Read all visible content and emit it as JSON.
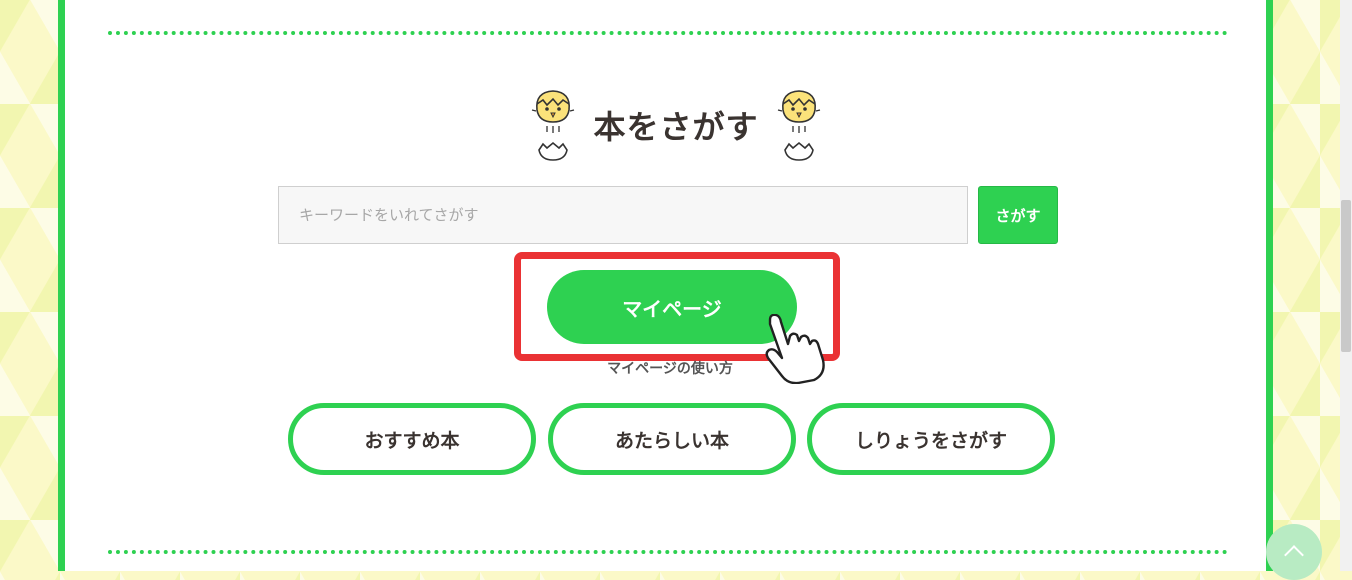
{
  "search_section": {
    "heading": "本をさがす",
    "search_input": {
      "value": "",
      "placeholder": "キーワードをいれてさがす"
    },
    "search_button_label": "さがす",
    "mypage_button_label": "マイページ",
    "mypage_help_link": "マイページの使い方",
    "category_buttons": [
      {
        "label": "おすすめ本"
      },
      {
        "label": "あたらしい本"
      },
      {
        "label": "しりょうをさがす"
      }
    ]
  },
  "colors": {
    "accent_green": "#2ed151",
    "highlight_red": "#ea3234",
    "page_background": "#fbf9c8"
  },
  "icons": {
    "left_decoration": "chick-hatching-icon",
    "right_decoration": "chick-hatching-icon",
    "cursor": "hand-pointer-icon",
    "back_to_top": "chevron-up-icon"
  }
}
